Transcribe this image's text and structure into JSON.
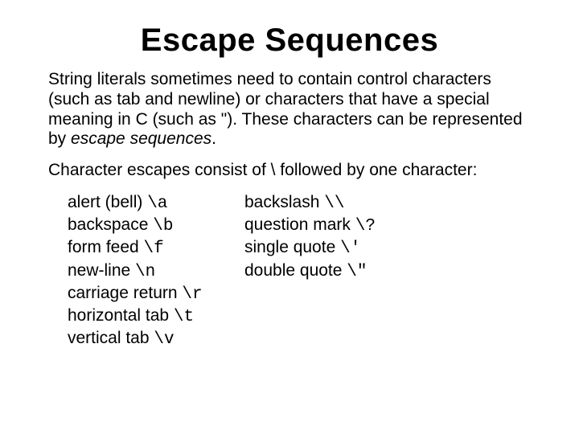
{
  "title": "Escape Sequences",
  "para1_a": "String literals sometimes need to contain control characters (such as tab and newline) or characters that have a special meaning in C (such as \"). These characters can be represented by ",
  "para1_b": "escape sequences",
  "para1_c": ".",
  "para2": "Character escapes consist of \\ followed by one character:",
  "col1": {
    "r0": {
      "label": "alert (bell) ",
      "code": "\\a"
    },
    "r1": {
      "label": "backspace ",
      "code": "\\b"
    },
    "r2": {
      "label": "form feed ",
      "code": "\\f"
    },
    "r3": {
      "label": "new-line ",
      "code": "\\n"
    },
    "r4": {
      "label": "carriage return ",
      "code": "\\r"
    },
    "r5": {
      "label": "horizontal tab ",
      "code": "\\t"
    },
    "r6": {
      "label": "vertical tab ",
      "code": "\\v"
    }
  },
  "col2": {
    "r0": {
      "label": "backslash ",
      "code": "\\\\"
    },
    "r1": {
      "label": "question mark ",
      "code": "\\?"
    },
    "r2": {
      "label": "single quote ",
      "code": "\\'"
    },
    "r3": {
      "label": "double quote ",
      "code": "\\\""
    }
  }
}
